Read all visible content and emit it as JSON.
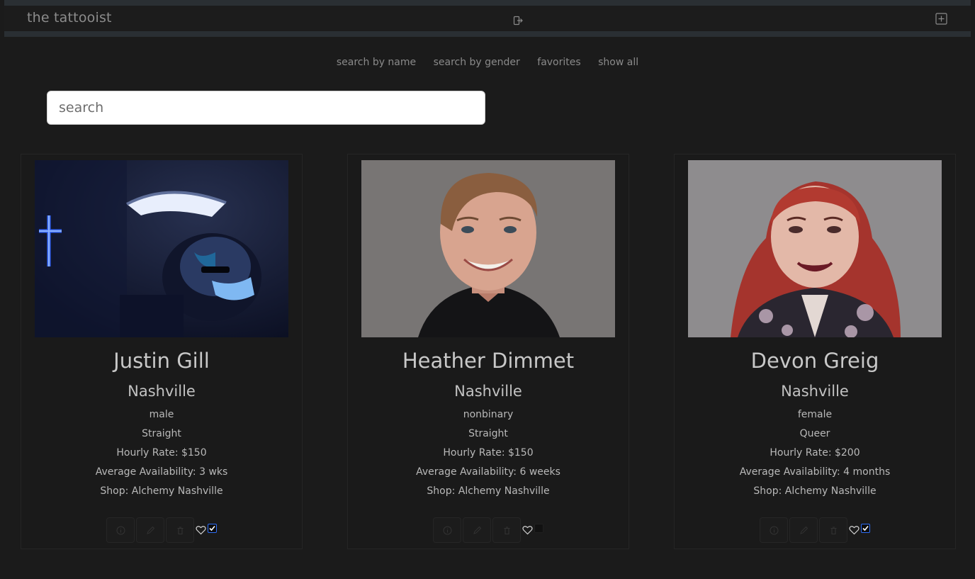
{
  "header": {
    "brand": "the tattooist",
    "logout_icon": "logout-icon",
    "add_icon": "plus-square-icon"
  },
  "nav": {
    "items": [
      "search by name",
      "search by gender",
      "favorites",
      "show all"
    ]
  },
  "search": {
    "placeholder": "search",
    "value": ""
  },
  "artists": [
    {
      "name": "Justin Gill",
      "city": "Nashville",
      "gender": "male",
      "orientation": "Straight",
      "rate": "Hourly Rate: $150",
      "availability": "Average Availability: 3 wks",
      "shop": "Shop: Alchemy Nashville",
      "favorite": true
    },
    {
      "name": "Heather Dimmet",
      "city": "Nashville",
      "gender": "nonbinary",
      "orientation": "Straight",
      "rate": "Hourly Rate: $150",
      "availability": "Average Availability: 6 weeks",
      "shop": "Shop: Alchemy Nashville",
      "favorite": false
    },
    {
      "name": "Devon Greig",
      "city": "Nashville",
      "gender": "female",
      "orientation": "Queer",
      "rate": "Hourly Rate: $200",
      "availability": "Average Availability: 4 months",
      "shop": "Shop: Alchemy Nashville",
      "favorite": true
    }
  ],
  "colors": {
    "background": "#1b1b1b",
    "checkbox_accent": "#2e6df6"
  }
}
